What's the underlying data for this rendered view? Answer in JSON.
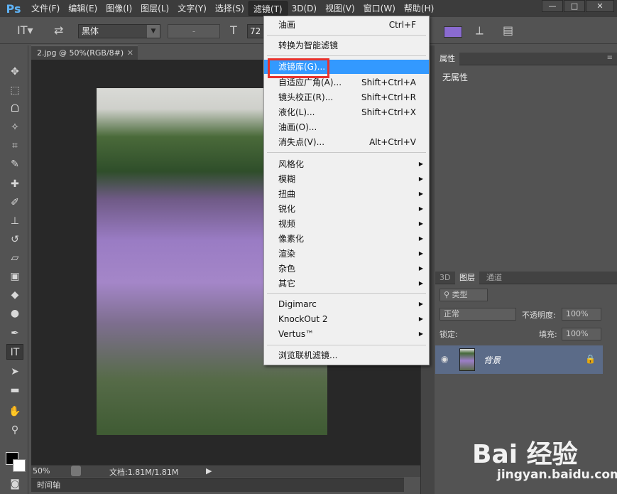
{
  "app": {
    "logo": "Ps",
    "menus": [
      "文件(F)",
      "编辑(E)",
      "图像(I)",
      "图层(L)",
      "文字(Y)",
      "选择(S)",
      "滤镜(T)",
      "3D(D)",
      "视图(V)",
      "窗口(W)",
      "帮助(H)"
    ],
    "active_menu": "滤镜(T)",
    "window_buttons": [
      "—",
      "□",
      "✕"
    ]
  },
  "options": {
    "font_family": "黑体",
    "font_style": "-",
    "font_size": "72",
    "text_color": "#8a6bd0"
  },
  "document": {
    "tab_title": "2.jpg @ 50%(RGB/8#)",
    "zoom": "50%",
    "doc_info": "文档:1.81M/1.81M",
    "timeline_label": "时间轴"
  },
  "filter_menu": {
    "items": [
      {
        "label": "油画",
        "shortcut": "Ctrl+F"
      },
      {
        "label": "转换为智能滤镜",
        "shortcut": ""
      },
      {
        "label": "滤镜库(G)...",
        "shortcut": ""
      },
      {
        "label": "自适应广角(A)...",
        "shortcut": "Shift+Ctrl+A"
      },
      {
        "label": "镜头校正(R)...",
        "shortcut": "Shift+Ctrl+R"
      },
      {
        "label": "液化(L)...",
        "shortcut": "Shift+Ctrl+X"
      },
      {
        "label": "油画(O)...",
        "shortcut": ""
      },
      {
        "label": "消失点(V)...",
        "shortcut": "Alt+Ctrl+V"
      },
      {
        "label": "风格化",
        "shortcut": ""
      },
      {
        "label": "模糊",
        "shortcut": ""
      },
      {
        "label": "扭曲",
        "shortcut": ""
      },
      {
        "label": "锐化",
        "shortcut": ""
      },
      {
        "label": "视频",
        "shortcut": ""
      },
      {
        "label": "像素化",
        "shortcut": ""
      },
      {
        "label": "渲染",
        "shortcut": ""
      },
      {
        "label": "杂色",
        "shortcut": ""
      },
      {
        "label": "其它",
        "shortcut": ""
      },
      {
        "label": "Digimarc",
        "shortcut": ""
      },
      {
        "label": "KnockOut 2",
        "shortcut": ""
      },
      {
        "label": "Vertus™",
        "shortcut": ""
      },
      {
        "label": "浏览联机滤镜...",
        "shortcut": ""
      }
    ],
    "highlighted": "滤镜库(G)..."
  },
  "properties_panel": {
    "tab": "属性",
    "content": "无属性"
  },
  "layers_panel": {
    "tabs": [
      "3D",
      "图层",
      "通道"
    ],
    "active_tab": "图层",
    "filter_kind": "类型",
    "blend_mode": "正常",
    "opacity_label": "不透明度:",
    "opacity_value": "100%",
    "lock_label": "锁定:",
    "fill_label": "填充:",
    "fill_value": "100%",
    "layers": [
      {
        "name": "背景",
        "locked": true,
        "visible": true
      }
    ]
  },
  "watermark": {
    "main": "Bai 经验",
    "sub": "jingyan.baidu.com"
  }
}
